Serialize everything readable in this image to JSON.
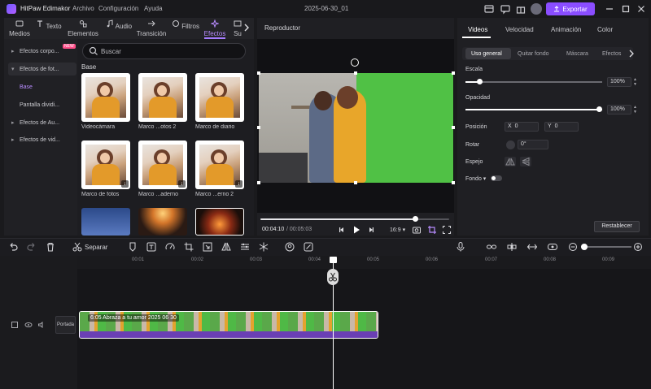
{
  "app": {
    "name": "HitPaw Edimakor",
    "menus": [
      "Archivo",
      "Configuración",
      "Ayuda"
    ],
    "project_title": "2025-06-30_01",
    "export_label": "Exportar",
    "accent": "#8a4dff"
  },
  "media_tabs": [
    {
      "label": "Medios",
      "icon": "media-icon"
    },
    {
      "label": "Texto",
      "icon": "text-icon"
    },
    {
      "label": "Elementos",
      "icon": "elements-icon"
    },
    {
      "label": "Audio",
      "icon": "music-icon"
    },
    {
      "label": "Transición",
      "icon": "transition-icon"
    },
    {
      "label": "Filtros",
      "icon": "filter-icon"
    },
    {
      "label": "Efectos",
      "icon": "effects-icon",
      "active": true
    },
    {
      "label": "Su",
      "icon": "subtitle-icon"
    }
  ],
  "sidebar": {
    "items": [
      {
        "label": "Efectos corpo...",
        "expanded": false
      },
      {
        "label": "Efectos de fot...",
        "expanded": true,
        "badge": "NEW"
      },
      {
        "label": "Base",
        "sub": true,
        "active": true
      },
      {
        "label": "Pantalla dividi...",
        "sub": true
      },
      {
        "label": "Efectos de Au...",
        "expanded": false
      },
      {
        "label": "Efectos de vid...",
        "expanded": false
      }
    ]
  },
  "effects": {
    "search_placeholder": "Buscar",
    "section": "Base",
    "items": [
      {
        "label": "Videocámara"
      },
      {
        "label": "Marco ...otos 2"
      },
      {
        "label": "Marco de diario"
      },
      {
        "label": "Marco de fotos"
      },
      {
        "label": "Marco ...aderno"
      },
      {
        "label": "Marco ...erno 2"
      }
    ]
  },
  "player": {
    "title": "Reproductor",
    "current_time": "00:04:10",
    "total_time": "/ 00:05:03",
    "aspect_ratio": "16:9",
    "progress": 0.82
  },
  "properties": {
    "tabs": [
      "Videos",
      "Velocidad",
      "Animación",
      "Color"
    ],
    "subtabs": [
      "Uso general",
      "Quitar fondo",
      "Máscara",
      "Efectos"
    ],
    "scale_label": "Escala",
    "scale_value": "100%",
    "scale_fraction": 0.1,
    "opacity_label": "Opacidad",
    "opacity_value": "100%",
    "opacity_fraction": 1.0,
    "position_label": "Posición",
    "pos_x_label": "X",
    "pos_x": "0",
    "pos_y_label": "Y",
    "pos_y": "0",
    "rotate_label": "Rotar",
    "rotate_value": "0°",
    "mirror_label": "Espejo",
    "background_label": "Fondo",
    "reset_label": "Restablecer"
  },
  "toolbar": {
    "split_label": "Separar"
  },
  "timeline": {
    "ruler": [
      "00:01",
      "00:02",
      "00:03",
      "00:04",
      "00:05",
      "00:06",
      "00:07",
      "00:08",
      "00:09"
    ],
    "cover_label": "Portada",
    "clip_title": "6:05 Abraza a tu amor 2025 06 30"
  }
}
